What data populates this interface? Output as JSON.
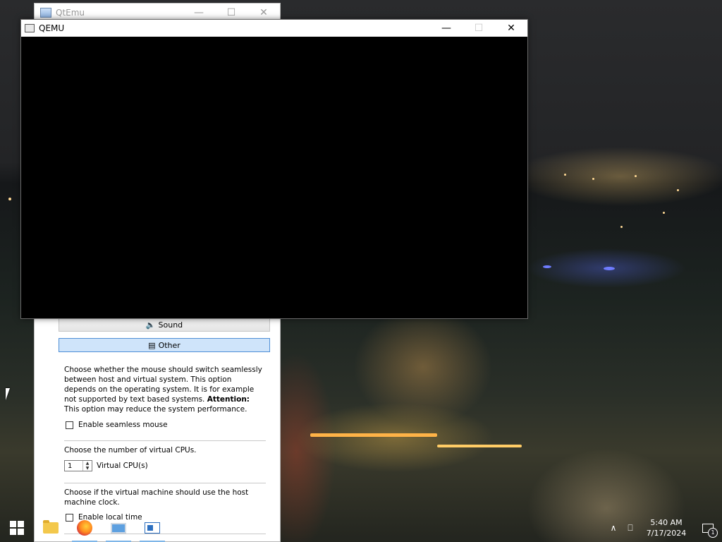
{
  "qtemu_window": {
    "title": "QtEmu",
    "minimize_glyph": "—",
    "maximize_glyph": "☐",
    "close_glyph": "✕",
    "sections": {
      "sound_label": "Sound",
      "other_label": "Other"
    },
    "seamless": {
      "description_part1": "Choose whether the mouse should switch seamlessly between host and virtual system. This option depends on the operating system. It is for example not supported by text based systems. ",
      "attention_label": "Attention:",
      "description_part2": " This option may reduce the system performance.",
      "checkbox_label": "Enable seamless mouse"
    },
    "cpus": {
      "description": "Choose the number of virtual CPUs.",
      "value": "1",
      "unit_label": "Virtual CPU(s)"
    },
    "clock": {
      "description": "Choose if the virtual machine should use the host machine clock.",
      "checkbox_label": "Enable local time"
    }
  },
  "qemu_window": {
    "title": "QEMU",
    "minimize_glyph": "—",
    "maximize_glyph": "☐",
    "close_glyph": "✕"
  },
  "taskbar": {
    "apps": [
      {
        "name": "File Explorer",
        "icon": "folder-icon",
        "active": false
      },
      {
        "name": "Firefox",
        "icon": "firefox-icon",
        "active": true
      },
      {
        "name": "QtEmu",
        "icon": "monitor-icon",
        "active": true
      },
      {
        "name": "QEMU",
        "icon": "window-icon",
        "active": true
      }
    ],
    "tray": {
      "chevron_glyph": "∧",
      "network_glyph": "⎕",
      "time": "5:40 AM",
      "date": "7/17/2024",
      "notification_count": "1"
    }
  },
  "colors": {
    "active_section_bg": "#cfe4fa",
    "active_section_border": "#4f8fd6",
    "taskbar_underline": "#7fb6e8"
  }
}
